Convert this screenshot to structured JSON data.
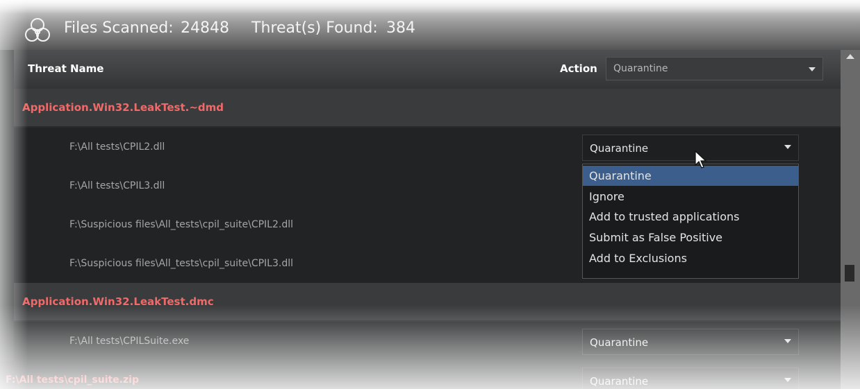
{
  "header": {
    "files_scanned_label": "Files Scanned:",
    "files_scanned_value": "24848",
    "threats_found_label": "Threat(s) Found:",
    "threats_found_value": "384"
  },
  "table": {
    "col_threat_name": "Threat Name",
    "col_action": "Action",
    "action_all_value": "Quarantine"
  },
  "groups": [
    {
      "name": "Application.Win32.LeakTest.~dmd",
      "files": [
        {
          "path": "F:\\All tests\\CPIL2.dll",
          "action": "Quarantine"
        },
        {
          "path": "F:\\All tests\\CPIL3.dll",
          "action": ""
        },
        {
          "path": "F:\\Suspicious files\\All_tests\\cpil_suite\\CPIL2.dll",
          "action": ""
        },
        {
          "path": "F:\\Suspicious files\\All_tests\\cpil_suite\\CPIL3.dll",
          "action": ""
        }
      ]
    },
    {
      "name": "Application.Win32.LeakTest.dmc",
      "files": [
        {
          "path": "F:\\All tests\\CPILSuite.exe",
          "action": "Quarantine"
        },
        {
          "path": "F:\\All tests\\cpil_suite.zip",
          "action": "Quarantine"
        }
      ]
    }
  ],
  "dropdown": {
    "options": [
      "Quarantine",
      "Ignore",
      "Add to trusted applications",
      "Submit as False Positive",
      "Add to Exclusions"
    ],
    "selected": "Quarantine"
  },
  "colors": {
    "threat_group_text": "#f06a6a",
    "selected_option_bg": "#3b5e8c"
  },
  "icons": {
    "header_icon": "biohazard-icon",
    "combo_caret": "chevron-down-icon",
    "pointer": "mouse-cursor-icon"
  }
}
